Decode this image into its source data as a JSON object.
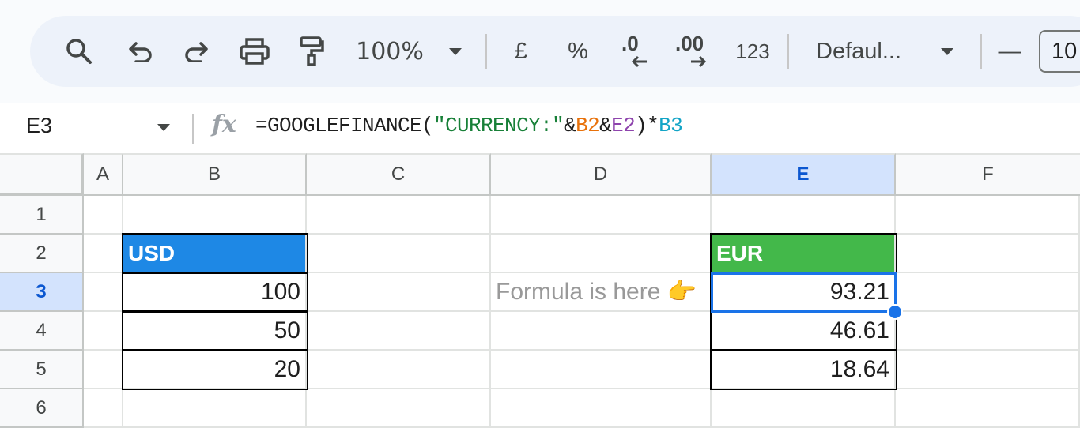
{
  "toolbar": {
    "search_icon": "search-icon",
    "undo_icon": "undo-icon",
    "redo_icon": "redo-icon",
    "print_icon": "print-icon",
    "paint_format_icon": "paint-format-icon",
    "zoom": "100%",
    "currency_label": "£",
    "percent_label": "%",
    "decrease_decimal_label": ".0",
    "increase_decimal_label": ".00",
    "number_format_label": "123",
    "font_family": "Defaul...",
    "minus_label": "—",
    "font_size": "10"
  },
  "formula_bar": {
    "name_box": "E3",
    "fx_label": "fx",
    "formula_prefix": "=GOOGLEFINANCE(",
    "formula_string": "\"CURRENCY:\"",
    "formula_amp1": "&",
    "formula_ref1": "B2",
    "formula_amp2": "&",
    "formula_ref2": "E2",
    "formula_mid": ")*",
    "formula_ref3": "B3"
  },
  "columns": [
    "A",
    "B",
    "C",
    "D",
    "E",
    "F"
  ],
  "rows": [
    "1",
    "2",
    "3",
    "4",
    "5",
    "6"
  ],
  "cells": {
    "B2": "USD",
    "B3": "100",
    "B4": "50",
    "B5": "20",
    "D3": "Formula is here 👉",
    "E2": "EUR",
    "E3": "93.21",
    "E4": "46.61",
    "E5": "18.64"
  },
  "colors": {
    "usd_header": "#1e88e5",
    "eur_header": "#43b84a",
    "selection": "#1a73e8"
  }
}
